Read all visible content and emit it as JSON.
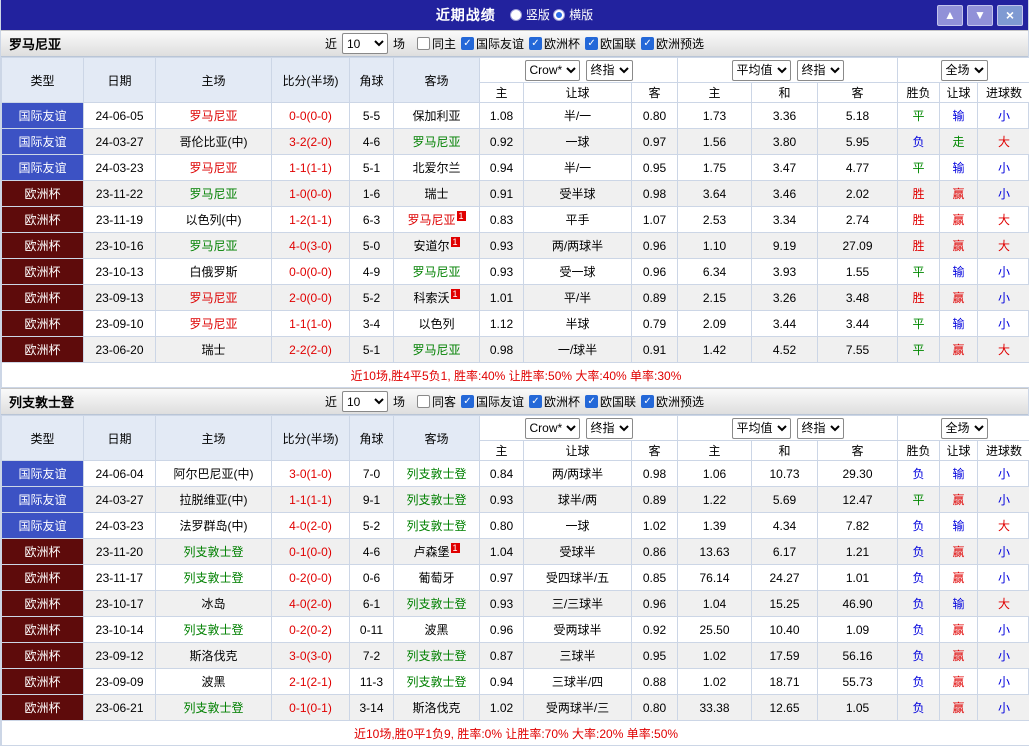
{
  "titlebar": {
    "title": "近期战绩",
    "layout_radios": [
      {
        "label": "竖版",
        "selected": false
      },
      {
        "label": "横版",
        "selected": true
      }
    ],
    "buttons": [
      {
        "name": "scroll-up-button",
        "icon": "arrow-up-icon",
        "glyph": "▲"
      },
      {
        "name": "scroll-down-button",
        "icon": "arrow-down-icon",
        "glyph": "▼"
      },
      {
        "name": "close-button",
        "icon": "close-icon",
        "glyph": "×"
      }
    ]
  },
  "palette": {
    "titlebar_bg": "#22229e",
    "type_friendly_bg": "#3c52c4",
    "type_eurocup_bg": "#5e0b0b",
    "team_red": "#dd0000",
    "team_green": "#008000",
    "win_red": "#e00000",
    "draw_green": "#008800",
    "loss_blue": "#0000dd",
    "summary_red": "#e00000"
  },
  "filter_labels": {
    "recent": "近",
    "matches": "场"
  },
  "table": {
    "left_columns": [
      "类型",
      "日期",
      "主场",
      "比分(半场)",
      "角球",
      "客场"
    ],
    "sub_columns": [
      "主",
      "让球",
      "客",
      "主",
      "和",
      "客",
      "胜负",
      "让球",
      "进球数"
    ],
    "selects": {
      "bookmaker": "Crow*",
      "bookmaker_index": "终指",
      "average": "平均值",
      "average_index": "终指",
      "scope": "全场"
    }
  },
  "sections": [
    {
      "team": "罗马尼亚",
      "filter": {
        "recent_count": "10",
        "same_side_label": "同主",
        "same_side_checked": false,
        "competitions": [
          {
            "label": "国际友谊",
            "checked": true
          },
          {
            "label": "欧洲杯",
            "checked": true
          },
          {
            "label": "欧国联",
            "checked": true
          },
          {
            "label": "欧洲预选",
            "checked": true
          }
        ]
      },
      "rows": [
        {
          "type": "国际友谊",
          "type_color": "blue",
          "date": "24-06-05",
          "home": "罗马尼亚",
          "home_color": "red",
          "home_badge": "",
          "score": "0-0(0-0)",
          "corners": "5-5",
          "away": "保加利亚",
          "away_color": "black",
          "away_badge": "",
          "ah": [
            "1.08",
            "半/一",
            "0.80"
          ],
          "eu": [
            "1.73",
            "3.36",
            "5.18"
          ],
          "res": [
            {
              "t": "平",
              "c": "green"
            },
            {
              "t": "输",
              "c": "blue"
            },
            {
              "t": "小",
              "c": "blue"
            }
          ]
        },
        {
          "type": "国际友谊",
          "type_color": "blue",
          "date": "24-03-27",
          "home": "哥伦比亚(中)",
          "home_color": "black",
          "home_badge": "",
          "score": "3-2(2-0)",
          "corners": "4-6",
          "away": "罗马尼亚",
          "away_color": "green",
          "away_badge": "",
          "ah": [
            "0.92",
            "一球",
            "0.97"
          ],
          "eu": [
            "1.56",
            "3.80",
            "5.95"
          ],
          "res": [
            {
              "t": "负",
              "c": "blue"
            },
            {
              "t": "走",
              "c": "green"
            },
            {
              "t": "大",
              "c": "red"
            }
          ]
        },
        {
          "type": "国际友谊",
          "type_color": "blue",
          "date": "24-03-23",
          "home": "罗马尼亚",
          "home_color": "red",
          "home_badge": "",
          "score": "1-1(1-1)",
          "corners": "5-1",
          "away": "北爱尔兰",
          "away_color": "black",
          "away_badge": "",
          "ah": [
            "0.94",
            "半/一",
            "0.95"
          ],
          "eu": [
            "1.75",
            "3.47",
            "4.77"
          ],
          "res": [
            {
              "t": "平",
              "c": "green"
            },
            {
              "t": "输",
              "c": "blue"
            },
            {
              "t": "小",
              "c": "blue"
            }
          ]
        },
        {
          "type": "欧洲杯",
          "type_color": "maroon",
          "date": "23-11-22",
          "home": "罗马尼亚",
          "home_color": "green",
          "home_badge": "",
          "score": "1-0(0-0)",
          "corners": "1-6",
          "away": "瑞士",
          "away_color": "black",
          "away_badge": "",
          "ah": [
            "0.91",
            "受半球",
            "0.98"
          ],
          "eu": [
            "3.64",
            "3.46",
            "2.02"
          ],
          "res": [
            {
              "t": "胜",
              "c": "red"
            },
            {
              "t": "赢",
              "c": "red"
            },
            {
              "t": "小",
              "c": "blue"
            }
          ]
        },
        {
          "type": "欧洲杯",
          "type_color": "maroon",
          "date": "23-11-19",
          "home": "以色列(中)",
          "home_color": "black",
          "home_badge": "",
          "score": "1-2(1-1)",
          "corners": "6-3",
          "away": "罗马尼亚",
          "away_color": "red",
          "away_badge": "1",
          "ah": [
            "0.83",
            "平手",
            "1.07"
          ],
          "eu": [
            "2.53",
            "3.34",
            "2.74"
          ],
          "res": [
            {
              "t": "胜",
              "c": "red"
            },
            {
              "t": "赢",
              "c": "red"
            },
            {
              "t": "大",
              "c": "red"
            }
          ]
        },
        {
          "type": "欧洲杯",
          "type_color": "maroon",
          "date": "23-10-16",
          "home": "罗马尼亚",
          "home_color": "green",
          "home_badge": "",
          "score": "4-0(3-0)",
          "corners": "5-0",
          "away": "安道尔",
          "away_color": "black",
          "away_badge": "1",
          "ah": [
            "0.93",
            "两/两球半",
            "0.96"
          ],
          "eu": [
            "1.10",
            "9.19",
            "27.09"
          ],
          "res": [
            {
              "t": "胜",
              "c": "red"
            },
            {
              "t": "赢",
              "c": "red"
            },
            {
              "t": "大",
              "c": "red"
            }
          ]
        },
        {
          "type": "欧洲杯",
          "type_color": "maroon",
          "date": "23-10-13",
          "home": "白俄罗斯",
          "home_color": "black",
          "home_badge": "",
          "score": "0-0(0-0)",
          "corners": "4-9",
          "away": "罗马尼亚",
          "away_color": "green",
          "away_badge": "",
          "ah": [
            "0.93",
            "受一球",
            "0.96"
          ],
          "eu": [
            "6.34",
            "3.93",
            "1.55"
          ],
          "res": [
            {
              "t": "平",
              "c": "green"
            },
            {
              "t": "输",
              "c": "blue"
            },
            {
              "t": "小",
              "c": "blue"
            }
          ]
        },
        {
          "type": "欧洲杯",
          "type_color": "maroon",
          "date": "23-09-13",
          "home": "罗马尼亚",
          "home_color": "red",
          "home_badge": "",
          "score": "2-0(0-0)",
          "corners": "5-2",
          "away": "科索沃",
          "away_color": "black",
          "away_badge": "1",
          "ah": [
            "1.01",
            "平/半",
            "0.89"
          ],
          "eu": [
            "2.15",
            "3.26",
            "3.48"
          ],
          "res": [
            {
              "t": "胜",
              "c": "red"
            },
            {
              "t": "赢",
              "c": "red"
            },
            {
              "t": "小",
              "c": "blue"
            }
          ]
        },
        {
          "type": "欧洲杯",
          "type_color": "maroon",
          "date": "23-09-10",
          "home": "罗马尼亚",
          "home_color": "red",
          "home_badge": "",
          "score": "1-1(1-0)",
          "corners": "3-4",
          "away": "以色列",
          "away_color": "black",
          "away_badge": "",
          "ah": [
            "1.12",
            "半球",
            "0.79"
          ],
          "eu": [
            "2.09",
            "3.44",
            "3.44"
          ],
          "res": [
            {
              "t": "平",
              "c": "green"
            },
            {
              "t": "输",
              "c": "blue"
            },
            {
              "t": "小",
              "c": "blue"
            }
          ]
        },
        {
          "type": "欧洲杯",
          "type_color": "maroon",
          "date": "23-06-20",
          "home": "瑞士",
          "home_color": "black",
          "home_badge": "",
          "score": "2-2(2-0)",
          "corners": "5-1",
          "away": "罗马尼亚",
          "away_color": "green",
          "away_badge": "",
          "ah": [
            "0.98",
            "一/球半",
            "0.91"
          ],
          "eu": [
            "1.42",
            "4.52",
            "7.55"
          ],
          "res": [
            {
              "t": "平",
              "c": "green"
            },
            {
              "t": "赢",
              "c": "red"
            },
            {
              "t": "大",
              "c": "red"
            }
          ]
        }
      ],
      "summary": "近10场,胜4平5负1, 胜率:40% 让胜率:50% 大率:40% 单率:30%"
    },
    {
      "team": "列支敦士登",
      "filter": {
        "recent_count": "10",
        "same_side_label": "同客",
        "same_side_checked": false,
        "competitions": [
          {
            "label": "国际友谊",
            "checked": true
          },
          {
            "label": "欧洲杯",
            "checked": true
          },
          {
            "label": "欧国联",
            "checked": true
          },
          {
            "label": "欧洲预选",
            "checked": true
          }
        ]
      },
      "rows": [
        {
          "type": "国际友谊",
          "type_color": "blue",
          "date": "24-06-04",
          "home": "阿尔巴尼亚(中)",
          "home_color": "black",
          "home_badge": "",
          "score": "3-0(1-0)",
          "corners": "7-0",
          "away": "列支敦士登",
          "away_color": "green",
          "away_badge": "",
          "ah": [
            "0.84",
            "两/两球半",
            "0.98"
          ],
          "eu": [
            "1.06",
            "10.73",
            "29.30"
          ],
          "res": [
            {
              "t": "负",
              "c": "blue"
            },
            {
              "t": "输",
              "c": "blue"
            },
            {
              "t": "小",
              "c": "blue"
            }
          ]
        },
        {
          "type": "国际友谊",
          "type_color": "blue",
          "date": "24-03-27",
          "home": "拉脱维亚(中)",
          "home_color": "black",
          "home_badge": "",
          "score": "1-1(1-1)",
          "corners": "9-1",
          "away": "列支敦士登",
          "away_color": "green",
          "away_badge": "",
          "ah": [
            "0.93",
            "球半/两",
            "0.89"
          ],
          "eu": [
            "1.22",
            "5.69",
            "12.47"
          ],
          "res": [
            {
              "t": "平",
              "c": "green"
            },
            {
              "t": "赢",
              "c": "red"
            },
            {
              "t": "小",
              "c": "blue"
            }
          ]
        },
        {
          "type": "国际友谊",
          "type_color": "blue",
          "date": "24-03-23",
          "home": "法罗群岛(中)",
          "home_color": "black",
          "home_badge": "",
          "score": "4-0(2-0)",
          "corners": "5-2",
          "away": "列支敦士登",
          "away_color": "green",
          "away_badge": "",
          "ah": [
            "0.80",
            "一球",
            "1.02"
          ],
          "eu": [
            "1.39",
            "4.34",
            "7.82"
          ],
          "res": [
            {
              "t": "负",
              "c": "blue"
            },
            {
              "t": "输",
              "c": "blue"
            },
            {
              "t": "大",
              "c": "red"
            }
          ]
        },
        {
          "type": "欧洲杯",
          "type_color": "maroon",
          "date": "23-11-20",
          "home": "列支敦士登",
          "home_color": "green",
          "home_badge": "",
          "score": "0-1(0-0)",
          "corners": "4-6",
          "away": "卢森堡",
          "away_color": "black",
          "away_badge": "1",
          "ah": [
            "1.04",
            "受球半",
            "0.86"
          ],
          "eu": [
            "13.63",
            "6.17",
            "1.21"
          ],
          "res": [
            {
              "t": "负",
              "c": "blue"
            },
            {
              "t": "赢",
              "c": "red"
            },
            {
              "t": "小",
              "c": "blue"
            }
          ]
        },
        {
          "type": "欧洲杯",
          "type_color": "maroon",
          "date": "23-11-17",
          "home": "列支敦士登",
          "home_color": "green",
          "home_badge": "",
          "score": "0-2(0-0)",
          "corners": "0-6",
          "away": "葡萄牙",
          "away_color": "black",
          "away_badge": "",
          "ah": [
            "0.97",
            "受四球半/五",
            "0.85"
          ],
          "eu": [
            "76.14",
            "24.27",
            "1.01"
          ],
          "res": [
            {
              "t": "负",
              "c": "blue"
            },
            {
              "t": "赢",
              "c": "red"
            },
            {
              "t": "小",
              "c": "blue"
            }
          ]
        },
        {
          "type": "欧洲杯",
          "type_color": "maroon",
          "date": "23-10-17",
          "home": "冰岛",
          "home_color": "black",
          "home_badge": "",
          "score": "4-0(2-0)",
          "corners": "6-1",
          "away": "列支敦士登",
          "away_color": "green",
          "away_badge": "",
          "ah": [
            "0.93",
            "三/三球半",
            "0.96"
          ],
          "eu": [
            "1.04",
            "15.25",
            "46.90"
          ],
          "res": [
            {
              "t": "负",
              "c": "blue"
            },
            {
              "t": "输",
              "c": "blue"
            },
            {
              "t": "大",
              "c": "red"
            }
          ]
        },
        {
          "type": "欧洲杯",
          "type_color": "maroon",
          "date": "23-10-14",
          "home": "列支敦士登",
          "home_color": "green",
          "home_badge": "",
          "score": "0-2(0-2)",
          "corners": "0-11",
          "away": "波黑",
          "away_color": "black",
          "away_badge": "",
          "ah": [
            "0.96",
            "受两球半",
            "0.92"
          ],
          "eu": [
            "25.50",
            "10.40",
            "1.09"
          ],
          "res": [
            {
              "t": "负",
              "c": "blue"
            },
            {
              "t": "赢",
              "c": "red"
            },
            {
              "t": "小",
              "c": "blue"
            }
          ]
        },
        {
          "type": "欧洲杯",
          "type_color": "maroon",
          "date": "23-09-12",
          "home": "斯洛伐克",
          "home_color": "black",
          "home_badge": "",
          "score": "3-0(3-0)",
          "corners": "7-2",
          "away": "列支敦士登",
          "away_color": "green",
          "away_badge": "",
          "ah": [
            "0.87",
            "三球半",
            "0.95"
          ],
          "eu": [
            "1.02",
            "17.59",
            "56.16"
          ],
          "res": [
            {
              "t": "负",
              "c": "blue"
            },
            {
              "t": "赢",
              "c": "red"
            },
            {
              "t": "小",
              "c": "blue"
            }
          ]
        },
        {
          "type": "欧洲杯",
          "type_color": "maroon",
          "date": "23-09-09",
          "home": "波黑",
          "home_color": "black",
          "home_badge": "",
          "score": "2-1(2-1)",
          "corners": "11-3",
          "away": "列支敦士登",
          "away_color": "green",
          "away_badge": "",
          "ah": [
            "0.94",
            "三球半/四",
            "0.88"
          ],
          "eu": [
            "1.02",
            "18.71",
            "55.73"
          ],
          "res": [
            {
              "t": "负",
              "c": "blue"
            },
            {
              "t": "赢",
              "c": "red"
            },
            {
              "t": "小",
              "c": "blue"
            }
          ]
        },
        {
          "type": "欧洲杯",
          "type_color": "maroon",
          "date": "23-06-21",
          "home": "列支敦士登",
          "home_color": "green",
          "home_badge": "",
          "score": "0-1(0-1)",
          "corners": "3-14",
          "away": "斯洛伐克",
          "away_color": "black",
          "away_badge": "",
          "ah": [
            "1.02",
            "受两球半/三",
            "0.80"
          ],
          "eu": [
            "33.38",
            "12.65",
            "1.05"
          ],
          "res": [
            {
              "t": "负",
              "c": "blue"
            },
            {
              "t": "赢",
              "c": "red"
            },
            {
              "t": "小",
              "c": "blue"
            }
          ]
        }
      ],
      "summary": "近10场,胜0平1负9, 胜率:0% 让胜率:70% 大率:20% 单率:50%"
    }
  ]
}
